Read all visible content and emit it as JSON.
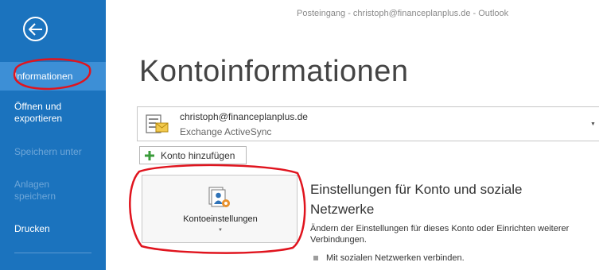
{
  "window": {
    "title": "Posteingang - christoph@financeplanplus.de - Outlook"
  },
  "sidebar": {
    "items": [
      {
        "label": "Informationen",
        "state": "selected"
      },
      {
        "label": "Öffnen und exportieren",
        "state": "enabled"
      },
      {
        "label": "Speichern unter",
        "state": "disabled"
      },
      {
        "label": "Anlagen speichern",
        "state": "disabled"
      },
      {
        "label": "Drucken",
        "state": "enabled"
      }
    ]
  },
  "main": {
    "title": "Kontoinformationen",
    "account": {
      "email": "christoph@financeplanplus.de",
      "type": "Exchange ActiveSync"
    },
    "add_account_label": "Konto hinzufügen",
    "settings_button_label": "Kontoeinstellungen",
    "section": {
      "heading": "Einstellungen für Konto und soziale Netzwerke",
      "description": "Ändern der Einstellungen für dieses Konto oder Einrichten weiterer Verbindungen.",
      "bullet": "Mit sozialen Netzwerken verbinden."
    }
  },
  "colors": {
    "sidebar_bg": "#1b73be",
    "sidebar_selected_bg": "#3d8fd6",
    "annotation_red": "#e0141e"
  }
}
